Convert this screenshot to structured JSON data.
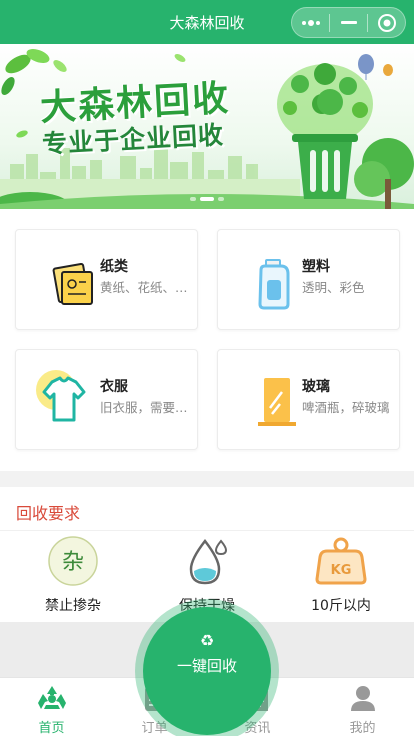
{
  "header": {
    "title": "大森林回收"
  },
  "banner": {
    "title_line1": "大森林回收",
    "title_line2": "专业于企业回收",
    "slide_count": 3,
    "active_slide": 1
  },
  "categories": [
    {
      "title": "纸类",
      "subtitle": "黄纸、花纸、书本"
    },
    {
      "title": "塑料",
      "subtitle": "透明、彩色"
    },
    {
      "title": "衣服",
      "subtitle": "旧衣服，需要干净"
    },
    {
      "title": "玻璃",
      "subtitle": "啤酒瓶，碎玻璃"
    }
  ],
  "requirements": {
    "title": "回收要求",
    "items": [
      {
        "label": "禁止掺杂",
        "icon_text": "杂"
      },
      {
        "label": "保持干燥",
        "icon_text": ""
      },
      {
        "label": "10斤以内",
        "icon_text": "KG"
      }
    ]
  },
  "recycle_button": {
    "icon": "♻",
    "label": "一键回收"
  },
  "tabbar": [
    {
      "label": "首页",
      "icon": "recycle-icon",
      "active": true
    },
    {
      "label": "订单",
      "icon": "order-icon",
      "active": false
    },
    {
      "label": "资讯",
      "icon": "news-icon",
      "active": false
    },
    {
      "label": "我的",
      "icon": "user-icon",
      "active": false
    }
  ],
  "colors": {
    "accent": "#27b36d",
    "requirement_title": "#d94a3a",
    "tab_inactive": "#999999"
  }
}
